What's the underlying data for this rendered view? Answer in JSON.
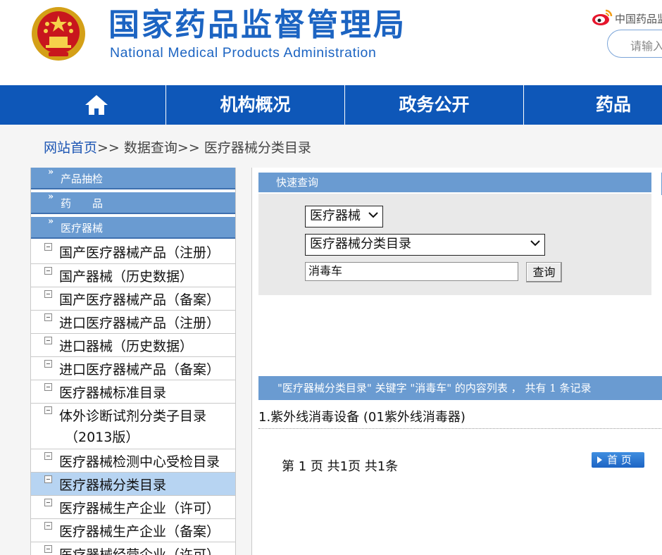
{
  "header": {
    "site_title": "国家药品监督管理局",
    "site_subtitle": "National Medical Products Administration",
    "weibo_label": "中国药品监",
    "search_placeholder": "请输入"
  },
  "nav": {
    "home_icon": "home-icon",
    "items": [
      {
        "label": "机构概况"
      },
      {
        "label": "政务公开"
      },
      {
        "label": "药品"
      }
    ]
  },
  "breadcrumb": {
    "home": "网站首页",
    "sep1": ">>",
    "data_query": "数据查询",
    "sep2": ">>",
    "current": "医疗器械分类目录"
  },
  "sidebar": {
    "sections": [
      {
        "label": "产品抽检"
      },
      {
        "label": "药　　品"
      },
      {
        "label": "医疗器械"
      }
    ],
    "items": [
      {
        "label": "国产医疗器械产品（注册）"
      },
      {
        "label": "国产器械（历史数据）"
      },
      {
        "label": "国产医疗器械产品（备案）"
      },
      {
        "label": "进口医疗器械产品（注册）"
      },
      {
        "label": "进口器械（历史数据）"
      },
      {
        "label": "进口医疗器械产品（备案）"
      },
      {
        "label": "医疗器械标准目录"
      },
      {
        "label": "体外诊断试剂分类子目录",
        "label2": "（2013版）"
      },
      {
        "label": "医疗器械检测中心受检目录"
      },
      {
        "label": "医疗器械分类目录",
        "active": true
      },
      {
        "label": "医疗器械生产企业（许可）"
      },
      {
        "label": "医疗器械生产企业（备案）"
      },
      {
        "label": "医疗器械经营企业（许可）"
      }
    ]
  },
  "quick_search": {
    "title": "快速查询",
    "category_select": "医疗器械",
    "catalog_select": "医疗器械分类目录",
    "keyword_value": "消毒车",
    "query_button": "查询"
  },
  "results": {
    "header": "\"医疗器械分类目录\" 关键字 \"消毒车\" 的内容列表 ，  共有 1 条记录",
    "items": [
      {
        "text": "1.紫外线消毒设备 (01紫外线消毒器)"
      }
    ],
    "pager_text": "第 1 页 共1页 共1条",
    "first_page_button": "首 页"
  },
  "colors": {
    "brand_blue": "#1c64c2",
    "nav_blue": "#0e57b8",
    "panel_blue": "#6a9bd1",
    "active_item": "#b7d4f2"
  }
}
